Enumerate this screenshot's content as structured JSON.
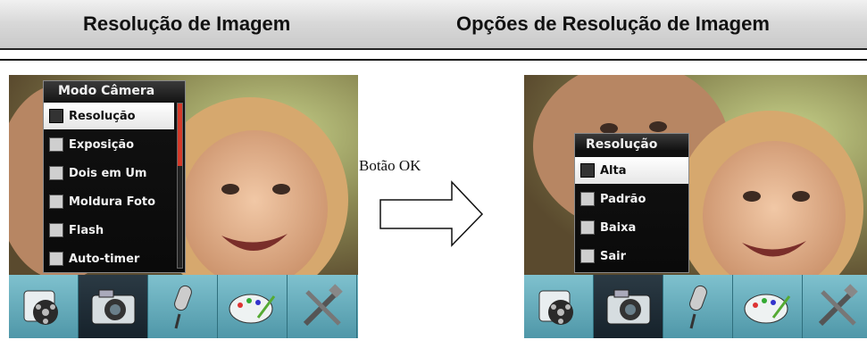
{
  "header": {
    "left_title": "Resolução de Imagem",
    "right_title": "Opções de Resolução de Imagem"
  },
  "middle": {
    "button_label": "Botão OK",
    "arrow_icon": "right-arrow-outline"
  },
  "left_screen": {
    "menu_title": "Modo Câmera",
    "items": [
      {
        "label": "Resolução",
        "icon": "resolution-icon",
        "selected": true
      },
      {
        "label": "Exposição",
        "icon": "exposure-icon",
        "selected": false
      },
      {
        "label": "Dois em Um",
        "icon": "two-in-one-icon",
        "selected": false
      },
      {
        "label": "Moldura Foto",
        "icon": "photo-frame-icon",
        "selected": false
      },
      {
        "label": "Flash",
        "icon": "flash-icon",
        "selected": false
      },
      {
        "label": "Auto-timer",
        "icon": "self-timer-icon",
        "selected": false
      }
    ],
    "toolbar": [
      "playback-film-icon",
      "camera-icon",
      "microphone-icon",
      "palette-icon",
      "tools-icon"
    ],
    "active_toolbar_index": 1
  },
  "right_screen": {
    "menu_title": "Resolução",
    "items": [
      {
        "label": "Alta",
        "icon": "high-res-icon",
        "selected": true
      },
      {
        "label": "Padrão",
        "icon": "standard-res-icon",
        "selected": false
      },
      {
        "label": "Baixa",
        "icon": "low-res-icon",
        "selected": false
      },
      {
        "label": "Sair",
        "icon": "exit-icon",
        "selected": false
      }
    ],
    "toolbar": [
      "playback-film-icon",
      "camera-icon",
      "microphone-icon",
      "palette-icon",
      "tools-icon"
    ],
    "active_toolbar_index": 1
  },
  "colors": {
    "toolbar": "#5fa8b8",
    "menu_bg": "#0a0a0a",
    "selected_item": "#ffffff",
    "scroll_thumb": "#d43a2a"
  }
}
